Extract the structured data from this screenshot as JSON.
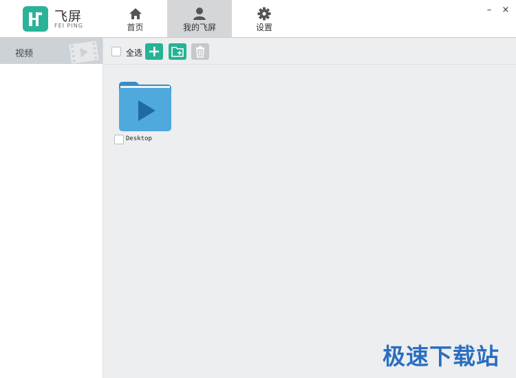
{
  "app": {
    "name_cn": "飞屏",
    "name_en": "FEI PING"
  },
  "nav": {
    "tabs": [
      {
        "label": "首页",
        "icon": "home-icon"
      },
      {
        "label": "我的飞屏",
        "icon": "user-icon",
        "active": true
      },
      {
        "label": "设置",
        "icon": "gear-icon"
      }
    ]
  },
  "window": {
    "minimize": "–",
    "close": "×"
  },
  "sidebar": {
    "items": [
      {
        "label": "视频",
        "icon": "video-film-icon",
        "active": true
      }
    ]
  },
  "toolbar": {
    "select_all_label": "全选"
  },
  "files": [
    {
      "name": "Desktop",
      "type": "video-folder"
    }
  ],
  "watermark": "极速下载站",
  "colors": {
    "accent": "#25b394",
    "folder": "#4fa9dc",
    "active_tab": "#d4d6d8",
    "content_bg": "#eceef0"
  }
}
